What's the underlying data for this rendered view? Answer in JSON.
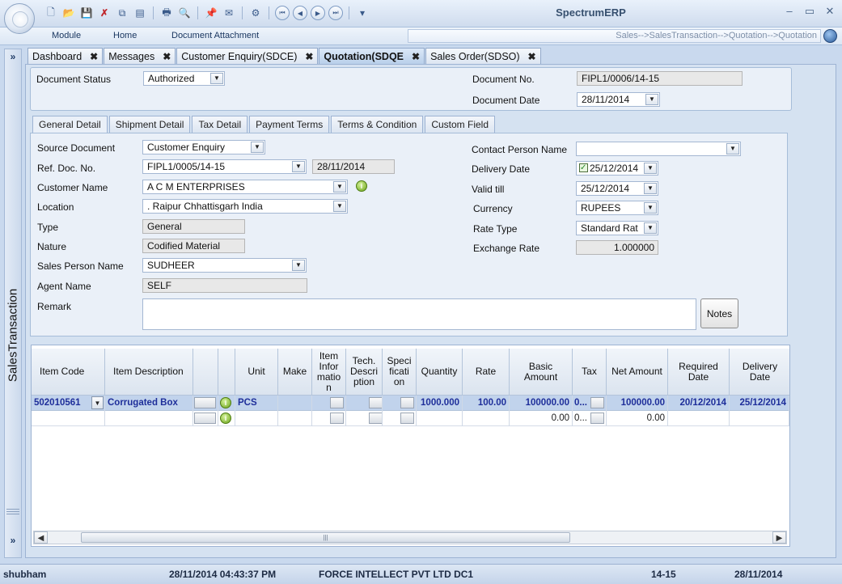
{
  "app": {
    "title": "SpectrumERP",
    "menu": [
      "Module",
      "Home",
      "Document Attachment"
    ],
    "breadcrumb": "Sales-->SalesTransaction-->Quotation-->Quotation",
    "side_panel_label": "SalesTransaction",
    "window_controls": {
      "minimize": "–",
      "restore": "▭",
      "close": "✕"
    }
  },
  "toolbar": {
    "icons": [
      "new-icon",
      "open-folder-icon",
      "save-icon",
      "delete-icon",
      "copy-icon",
      "layout-icon",
      "print-icon",
      "print-preview-icon",
      "export-icon",
      "email-icon",
      "workflow-icon",
      "first-record-icon",
      "previous-record-icon",
      "next-record-icon",
      "last-record-icon",
      "customize-icon"
    ],
    "glyphs": {
      "new": "🗋",
      "open": "📂",
      "save": "💾",
      "delete": "✗",
      "copy": "⧉",
      "layout": "▤",
      "print": "🖶",
      "preview": "🔍",
      "export": "📌",
      "email": "✉",
      "workflow": "⚙",
      "first": "⏮",
      "prev": "◀",
      "next": "▶",
      "last": "⏭",
      "customize": "▾"
    }
  },
  "doc_tabs": [
    {
      "label": "Dashboard",
      "close": "✖"
    },
    {
      "label": "Messages",
      "close": "✖"
    },
    {
      "label": "Customer Enquiry(SDCE)",
      "close": "✖"
    },
    {
      "label": "Quotation(SDQE",
      "close": "✖"
    },
    {
      "label": "Sales Order(SDSO)",
      "close": "✖"
    }
  ],
  "header": {
    "document_status_label": "Document Status",
    "document_status_value": "Authorized",
    "document_no_label": "Document No.",
    "document_no_value": "FIPL1/0006/14-15",
    "document_date_label": "Document Date",
    "document_date_value": "28/11/2014"
  },
  "section_tabs": [
    "General Detail",
    "Shipment Detail",
    "Tax Detail",
    "Payment Terms",
    "Terms & Condition",
    "Custom Field"
  ],
  "general": {
    "source_document_label": "Source Document",
    "source_document_value": "Customer Enquiry",
    "ref_doc_no_label": "Ref. Doc. No.",
    "ref_doc_no_value": "FIPL1/0005/14-15",
    "ref_doc_date_value": "28/11/2014",
    "customer_name_label": "Customer Name",
    "customer_name_value": "A C M ENTERPRISES",
    "location_label": "Location",
    "location_value": ". Raipur Chhattisgarh India",
    "type_label": "Type",
    "type_value": "General",
    "nature_label": "Nature",
    "nature_value": "Codified Material",
    "sales_person_label": "Sales Person Name",
    "sales_person_value": "SUDHEER",
    "agent_name_label": "Agent Name",
    "agent_name_value": "SELF",
    "remark_label": "Remark",
    "notes_button": "Notes",
    "contact_person_label": "Contact Person Name",
    "contact_person_value": "",
    "delivery_date_label": "Delivery Date",
    "delivery_date_value": "25/12/2014",
    "valid_till_label": "Valid till",
    "valid_till_value": "25/12/2014",
    "currency_label": "Currency",
    "currency_value": "RUPEES",
    "rate_type_label": "Rate Type",
    "rate_type_value": "Standard Rat",
    "exchange_rate_label": "Exchange Rate",
    "exchange_rate_value": "1.000000"
  },
  "grid": {
    "headers": {
      "item_code": "Item Code",
      "item_description": "Item Description",
      "unit": "Unit",
      "make": "Make",
      "item_information": "Item\nInfor\nmatio\nn",
      "tech_description": "Tech.\nDescri\nption",
      "specification": "Speci\nficati\non",
      "quantity": "Quantity",
      "rate": "Rate",
      "basic_amount": "Basic\nAmount",
      "tax": "Tax",
      "net_amount": "Net Amount",
      "required_date": "Required\nDate",
      "delivery_date": "Delivery\nDate"
    },
    "rows": [
      {
        "item_code": "502010561",
        "item_description": "Corrugated Box",
        "unit": "PCS",
        "quantity": "1000.000",
        "rate": "100.00",
        "basic_amount": "100000.00",
        "tax": "0...",
        "net_amount": "100000.00",
        "required_date": "20/12/2014",
        "delivery_date": "25/12/2014"
      },
      {
        "item_code": "",
        "item_description": "",
        "unit": "",
        "quantity": "",
        "rate": "",
        "basic_amount": "0.00",
        "tax": "0...",
        "net_amount": "0.00",
        "required_date": "",
        "delivery_date": ""
      }
    ]
  },
  "status": {
    "user": "shubham",
    "datetime": "28/11/2014 04:43:37 PM",
    "company": "FORCE INTELLECT PVT LTD DC1",
    "fiscal_year": "14-15",
    "date": "28/11/2014"
  }
}
